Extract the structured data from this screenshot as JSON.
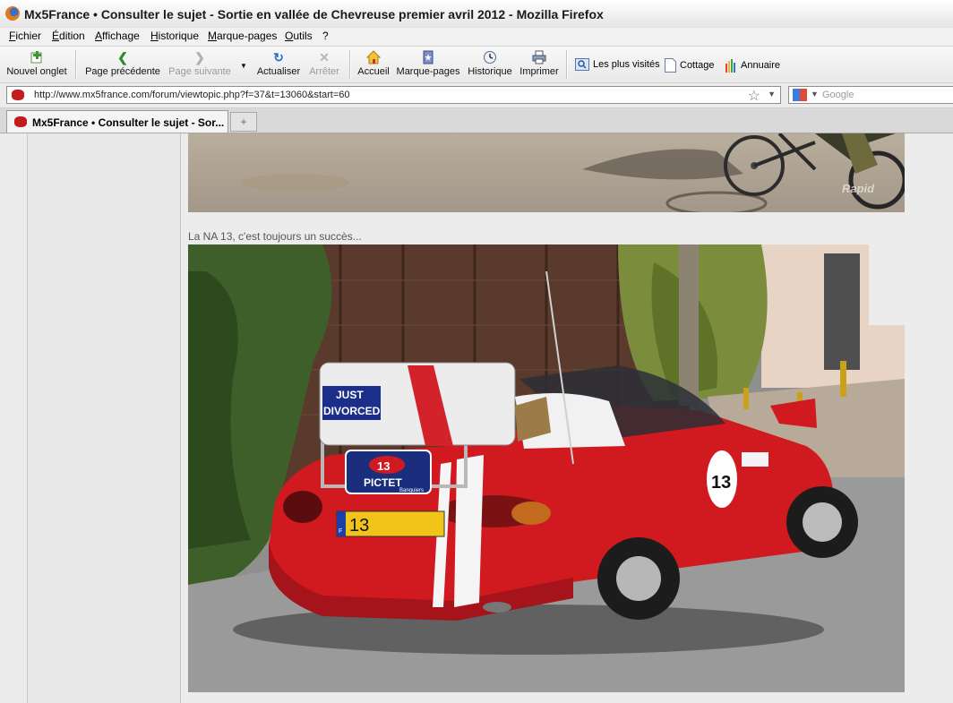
{
  "window": {
    "title": "Mx5France • Consulter le sujet - Sortie en vallée de Chevreuse premier avril 2012 - Mozilla Firefox"
  },
  "menu": [
    "Fichier",
    "Édition",
    "Affichage",
    "Historique",
    "Marque-pages",
    "Outils",
    "?"
  ],
  "toolbar": {
    "new_tab": "Nouvel onglet",
    "back": "Page précédente",
    "forward": "Page suivante",
    "reload": "Actualiser",
    "stop": "Arrêter",
    "home": "Accueil",
    "bookmarks": "Marque-pages",
    "history": "Historique",
    "print": "Imprimer"
  },
  "bookmarks_bar": [
    "Les plus visités",
    "Cottage",
    "Annuaire"
  ],
  "url": "http://www.mx5france.com/forum/viewtopic.php?f=37&t=13060&start=60",
  "search": {
    "placeholder": "Google"
  },
  "tab": {
    "label": "Mx5France • Consulter le sujet - Sor..."
  },
  "post": {
    "photo1_watermark": "Rapid",
    "caption": "La NA 13, c'est toujours un succès...",
    "photo2": {
      "luggage_sticker_line1": "JUST",
      "luggage_sticker_line2": "DIVORCED",
      "plate": "13",
      "plate_country": "F",
      "rally_number": "13",
      "rally_sponsor": "PICTET",
      "rally_sponsor_sub": "Banquiers",
      "door_number": "13"
    }
  },
  "colors": {
    "car_red": "#d11a1f",
    "stripe_white": "#f5f5f5"
  }
}
